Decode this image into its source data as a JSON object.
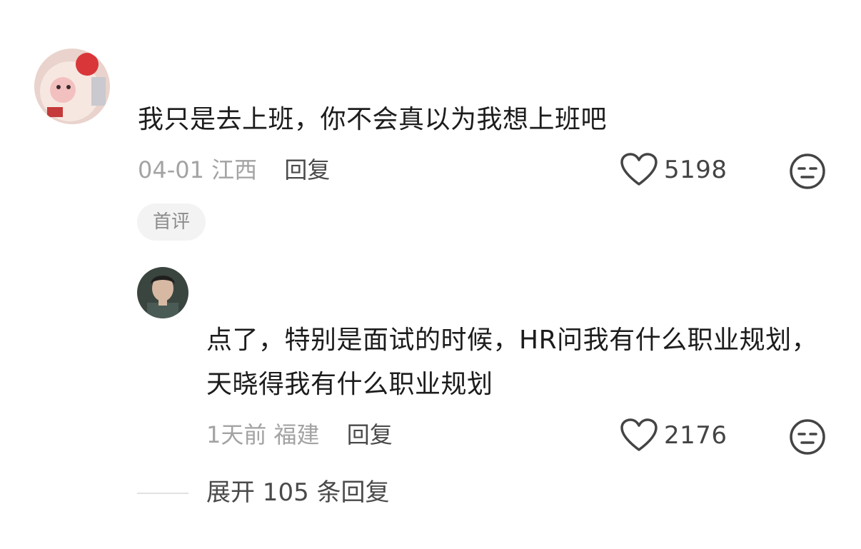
{
  "comment": {
    "text": "我只是去上班，你不会真以为我想上班吧",
    "date": "04-01",
    "location": "江西",
    "reply_label": "回复",
    "likes": "5198",
    "badge": "首评"
  },
  "reply": {
    "text": "点了，特别是面试的时候，HR问我有什么职业规划，天晓得我有什么职业规划",
    "date": "1天前",
    "location": "福建",
    "reply_label": "回复",
    "likes": "2176"
  },
  "expand": {
    "label": "展开 105 条回复"
  },
  "icons": {
    "like": "heart-outline-icon",
    "dislike": "unamused-face-icon"
  },
  "colors": {
    "meta_gray": "#a3a3a3",
    "text": "#1c1c1c",
    "badge_bg": "#f3f3f3"
  }
}
